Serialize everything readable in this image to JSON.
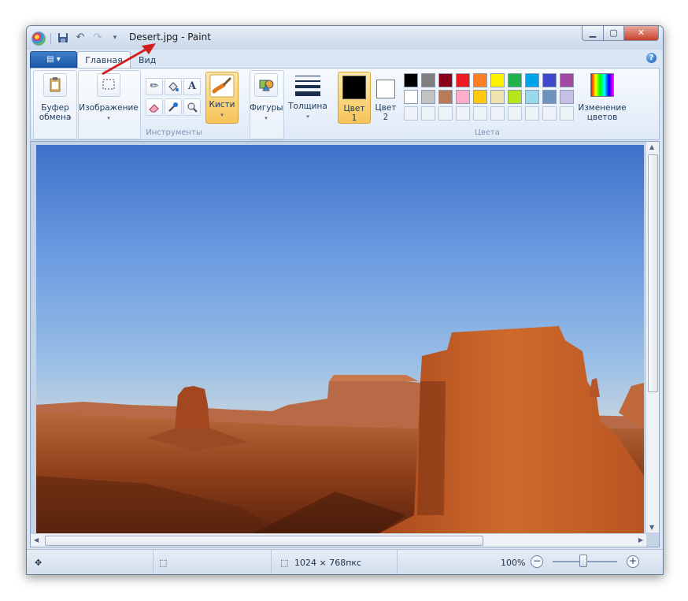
{
  "titlebar": {
    "title": "Desert.jpg - Paint",
    "undo_icon": "undo-icon",
    "redo_icon": "redo-icon",
    "save_icon": "save-icon"
  },
  "tabs": {
    "file_label": "▤ ▾",
    "home": "Главная",
    "view": "Вид"
  },
  "ribbon": {
    "clipboard": {
      "line1": "Буфер",
      "line2": "обмена"
    },
    "image": {
      "label": "Изображение"
    },
    "tools": {
      "group_label": "Инструменты"
    },
    "brushes": {
      "label": "Кисти"
    },
    "shapes": {
      "label": "Фигуры"
    },
    "size": {
      "label": "Толщина"
    },
    "color1": {
      "line1": "Цвет",
      "line2": "1",
      "value": "#000000"
    },
    "color2": {
      "line1": "Цвет",
      "line2": "2",
      "value": "#ffffff"
    },
    "colors_group_label": "Цвета",
    "edit_colors": {
      "line1": "Изменение",
      "line2": "цветов"
    },
    "palette_row1": [
      "#000000",
      "#7f7f7f",
      "#880015",
      "#ed1c24",
      "#ff7f27",
      "#fff200",
      "#22b14c",
      "#00a2e8",
      "#3f48cc",
      "#a349a4"
    ],
    "palette_row2": [
      "#ffffff",
      "#c3c3c3",
      "#b97a57",
      "#ffaec9",
      "#ffc90e",
      "#efe4b0",
      "#b5e61d",
      "#99d9ea",
      "#7092be",
      "#c8bfe7"
    ]
  },
  "status": {
    "image_size": "1024 × 768пкс",
    "zoom": "100%"
  },
  "colors": {
    "accent": "#1c56a6",
    "annotation_arrow": "#d21f1f"
  }
}
